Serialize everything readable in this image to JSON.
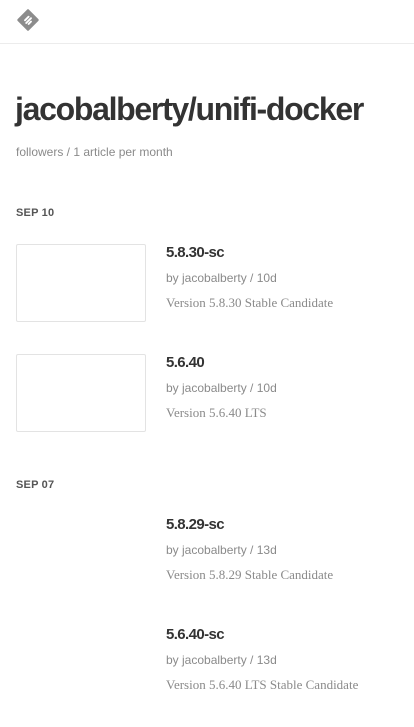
{
  "header": {
    "logo_icon": "feedly-logo-icon",
    "logo_color": "#8c8c8c"
  },
  "feed": {
    "title": "jacobalberty/unifi-docker",
    "subtitle": "followers / 1 article per month"
  },
  "sections": [
    {
      "date": "SEP 10",
      "articles": [
        {
          "title": "5.8.30-sc",
          "meta": "by jacobalberty / 10d",
          "summary": "Version 5.8.30 Stable Candidate",
          "has_thumbnail": true
        },
        {
          "title": "5.6.40",
          "meta": "by jacobalberty / 10d",
          "summary": "Version 5.6.40 LTS",
          "has_thumbnail": true
        }
      ]
    },
    {
      "date": "SEP 07",
      "articles": [
        {
          "title": "5.8.29-sc",
          "meta": "by jacobalberty / 13d",
          "summary": "Version 5.8.29 Stable Candidate",
          "has_thumbnail": false
        },
        {
          "title": "5.6.40-sc",
          "meta": "by jacobalberty / 13d",
          "summary": "Version 5.6.40 LTS Stable Candidate",
          "has_thumbnail": false
        }
      ]
    }
  ]
}
